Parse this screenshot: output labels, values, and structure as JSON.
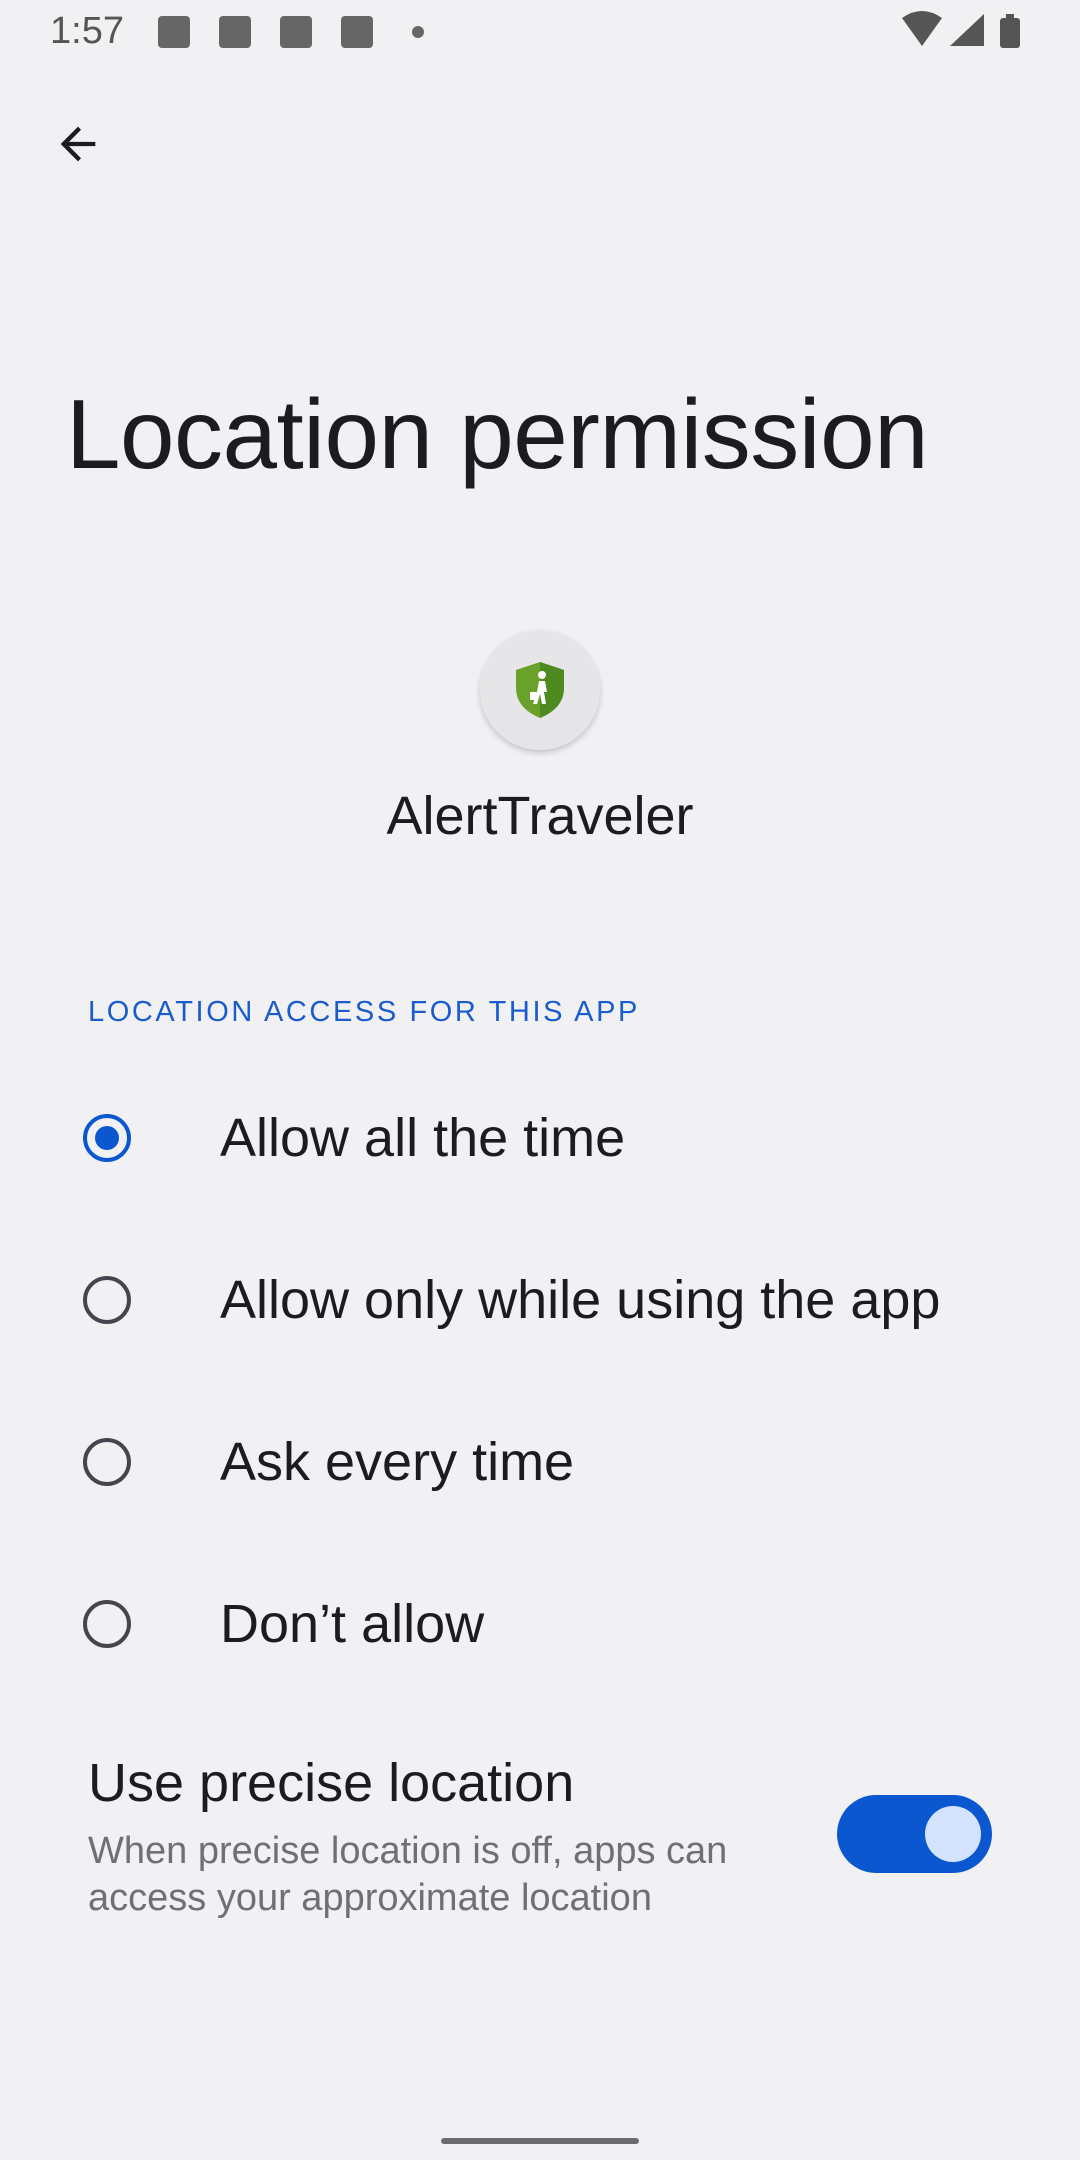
{
  "status_bar": {
    "time": "1:57",
    "icons": [
      "notification-icon",
      "notification-icon",
      "notification-icon",
      "notification-icon",
      "more-dot-icon",
      "wifi-icon",
      "signal-icon",
      "battery-icon"
    ]
  },
  "header": {
    "back_icon": "back-arrow-icon"
  },
  "page": {
    "title": "Location permission"
  },
  "app": {
    "name": "AlertTraveler",
    "icon": "shield-traveler-icon",
    "icon_colors": {
      "shield": "#6aa12b",
      "figure": "#ffffff"
    }
  },
  "location_access": {
    "section_title": "LOCATION ACCESS FOR THIS APP",
    "selected_index": 0,
    "options": [
      {
        "label": "Allow all the time",
        "selected": true
      },
      {
        "label": "Allow only while using the app",
        "selected": false
      },
      {
        "label": "Ask every time",
        "selected": false
      },
      {
        "label": "Don’t allow",
        "selected": false
      }
    ]
  },
  "precise_location": {
    "title": "Use precise location",
    "description": "When precise location is off, apps can access your approximate location",
    "enabled": true
  },
  "colors": {
    "accent": "#0b57d0",
    "background": "#f1f1f4",
    "toggle_thumb": "#d3e3fd"
  }
}
